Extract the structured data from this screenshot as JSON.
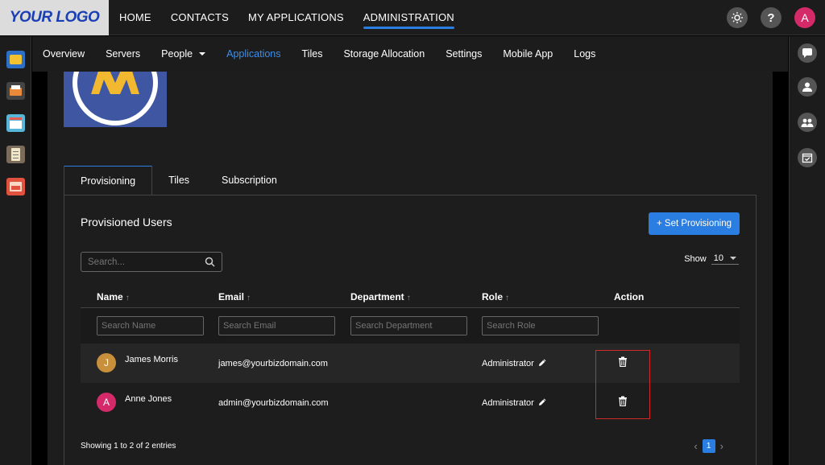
{
  "logo": {
    "text": "YOUR LOGO"
  },
  "topnav": {
    "items": [
      "HOME",
      "CONTACTS",
      "MY APPLICATIONS",
      "ADMINISTRATION"
    ],
    "active": "ADMINISTRATION"
  },
  "user": {
    "initial": "A"
  },
  "help": {
    "label": "?"
  },
  "subnav": {
    "items": [
      "Overview",
      "Servers",
      "People",
      "Applications",
      "Tiles",
      "Storage Allocation",
      "Settings",
      "Mobile App",
      "Logs"
    ],
    "active": "Applications"
  },
  "tabs": [
    "Provisioning",
    "Tiles",
    "Subscription"
  ],
  "panel": {
    "title": "Provisioned Users",
    "set_button": "+ Set Provisioning",
    "search_placeholder": "Search...",
    "show_label": "Show",
    "show_value": "10"
  },
  "table": {
    "headers": [
      "Name",
      "Email",
      "Department",
      "Role",
      "Action"
    ],
    "filter_placeholders": [
      "Search Name",
      "Search Email",
      "Search Department",
      "Search Role"
    ],
    "rows": [
      {
        "initial": "J",
        "avatar_color": "#c9903b",
        "name": "James Morris",
        "email": "james@yourbizdomain.com",
        "department": "",
        "role": "Administrator"
      },
      {
        "initial": "A",
        "avatar_color": "#d42a6a",
        "name": "Anne Jones",
        "email": "admin@yourbizdomain.com",
        "department": "",
        "role": "Administrator"
      }
    ]
  },
  "footer": {
    "entries": "Showing 1 to 2 of 2 entries",
    "page": "1"
  },
  "colors": {
    "accent": "#2a7de1",
    "highlight": "#d12a2a",
    "background": "#1d1d1d"
  },
  "icons": {
    "left_apps": [
      "folder-app-icon",
      "inbox-app-icon",
      "calendar-app-icon",
      "checklist-app-icon",
      "photos-app-icon"
    ],
    "right_tools": [
      "chat-icon",
      "user-icon",
      "group-icon",
      "calendar-check-icon"
    ],
    "row_actions": [
      "edit-icon",
      "trash-icon"
    ]
  }
}
